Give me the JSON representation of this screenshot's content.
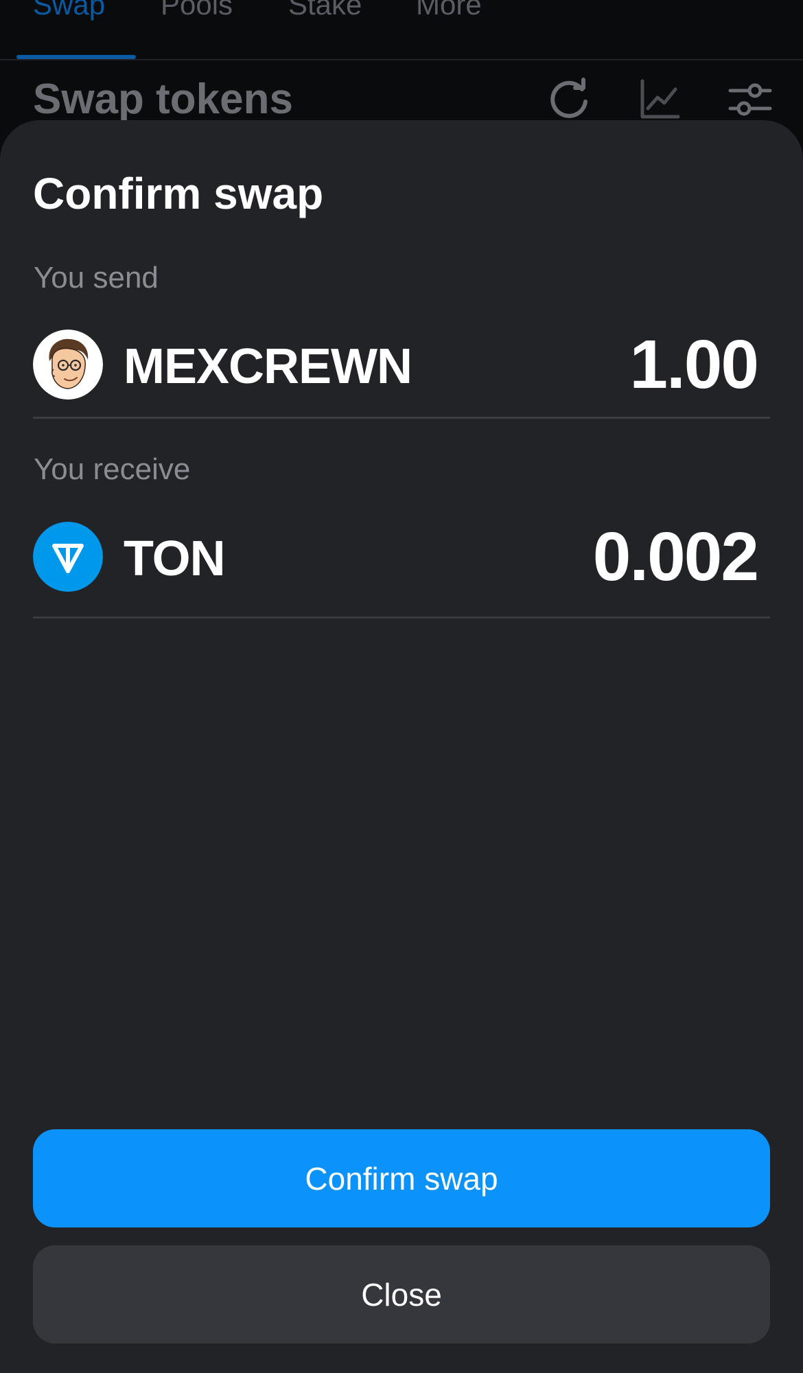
{
  "tabs": [
    "Swap",
    "Pools",
    "Stake",
    "More"
  ],
  "page_title": "Swap tokens",
  "header_icons": [
    "refresh-icon",
    "chart-icon",
    "settings-sliders-icon"
  ],
  "sheet": {
    "title": "Confirm swap",
    "send": {
      "label": "You send",
      "token": "MEXCREWN",
      "amount": "1.00",
      "icon": "mexcrewn-token-icon"
    },
    "receive": {
      "label": "You receive",
      "token": "TON",
      "amount": "0.002",
      "icon": "ton-token-icon"
    },
    "confirm_label": "Confirm swap",
    "close_label": "Close"
  },
  "colors": {
    "accent": "#0b93fb",
    "sheet_bg": "#222327",
    "ton_blue": "#0098ea"
  }
}
